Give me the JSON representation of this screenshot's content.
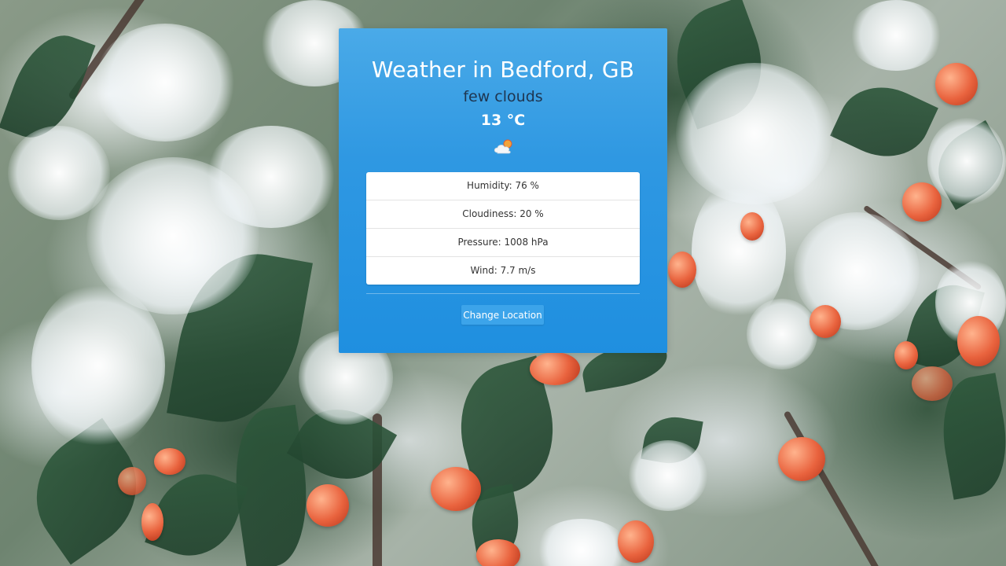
{
  "weather": {
    "title": "Weather in Bedford, GB",
    "condition": "few clouds",
    "temperature": "13 °C",
    "icon": "few-clouds-icon"
  },
  "details": [
    {
      "label": "Humidity: 76 %"
    },
    {
      "label": "Cloudiness: 20 %"
    },
    {
      "label": "Pressure: 1008 hPa"
    },
    {
      "label": "Wind: 7.7 m/s"
    }
  ],
  "actions": {
    "change_location_label": "Change Location"
  },
  "colors": {
    "card_blue": "#2f98e2",
    "condition_text": "#1e3550",
    "button_blue": "#3ca4ea"
  }
}
